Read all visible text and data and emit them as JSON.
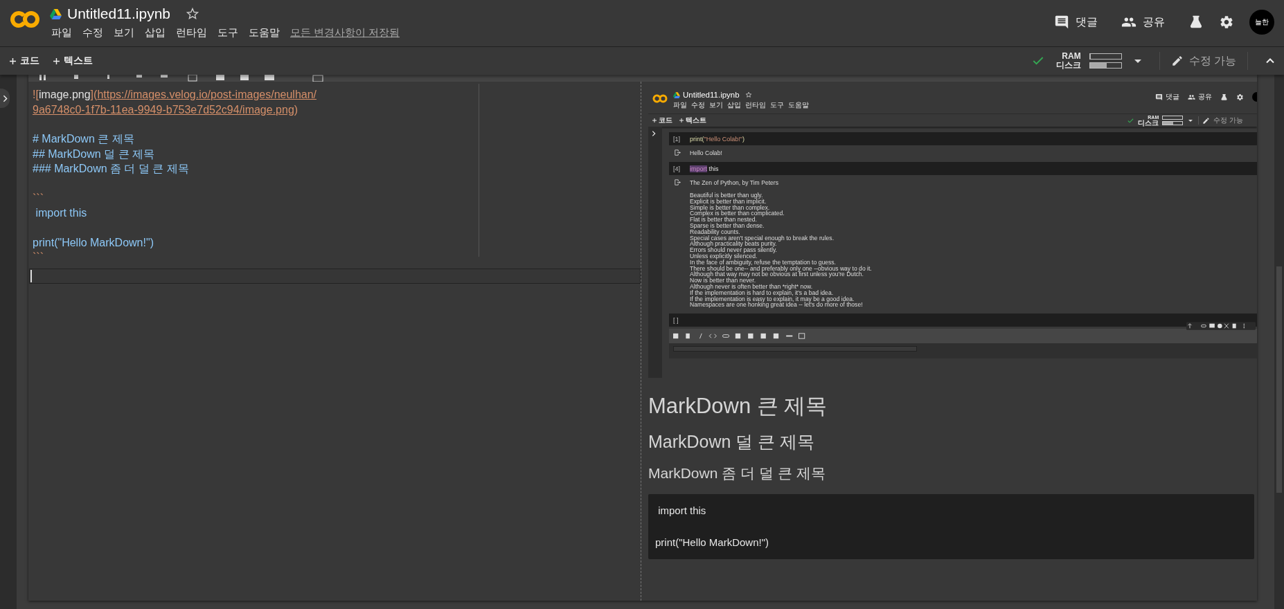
{
  "header": {
    "title": "Untitled11.ipynb",
    "menu": [
      "파일",
      "수정",
      "보기",
      "삽입",
      "런타임",
      "도구",
      "도움말"
    ],
    "save_status": "모든 변경사항이 저장됨",
    "actions": [
      {
        "kind": "comment",
        "label": "댓글"
      },
      {
        "kind": "share",
        "label": "공유"
      }
    ],
    "avatar": "늘한"
  },
  "toolbar": {
    "add_buttons": [
      "코드",
      "텍스트"
    ],
    "ram_label": "RAM",
    "disk_label": "디스크",
    "ram": {
      "level": 0.04
    },
    "disk": {
      "level": 0.55
    },
    "edit_status": "수정 가능"
  },
  "editor": {
    "lines": [
      {
        "kind": "text",
        "segments": [
          {
            "kind": "punct",
            "text": "!["
          },
          {
            "kind": "plain",
            "text": "image.png"
          },
          {
            "kind": "punct",
            "text": "]("
          },
          {
            "kind": "url",
            "text": "https://images.velog.io/post-images/neulhan/"
          }
        ]
      },
      {
        "kind": "text",
        "segments": [
          {
            "kind": "url",
            "text": "9a6748c0-1f7b-11ea-9949-b753e7d52c94/image.png"
          },
          {
            "kind": "punct",
            "text": ")"
          }
        ]
      },
      {
        "kind": "blank"
      },
      {
        "kind": "text",
        "segments": [
          {
            "kind": "heading",
            "text": "# MarkDown 큰 제목"
          }
        ]
      },
      {
        "kind": "text",
        "segments": [
          {
            "kind": "heading",
            "text": "## MarkDown 덜 큰 제목"
          }
        ]
      },
      {
        "kind": "text",
        "segments": [
          {
            "kind": "heading",
            "text": "### MarkDown 좀 더 덜 큰 제목"
          }
        ]
      },
      {
        "kind": "blank"
      },
      {
        "kind": "text",
        "segments": [
          {
            "kind": "punct",
            "text": "```"
          }
        ]
      },
      {
        "kind": "text",
        "segments": [
          {
            "kind": "code",
            "text": " import this"
          }
        ]
      },
      {
        "kind": "blank"
      },
      {
        "kind": "text",
        "segments": [
          {
            "kind": "code",
            "text": "print(\"Hello MarkDown!\")"
          }
        ]
      },
      {
        "kind": "text",
        "segments": [
          {
            "kind": "punct",
            "text": "```"
          }
        ]
      },
      {
        "kind": "cursor"
      }
    ]
  },
  "preview": {
    "screenshot": {
      "title": "Untitled11.ipynb",
      "menu": [
        "파일",
        "수정",
        "보기",
        "삽입",
        "런타임",
        "도구",
        "도움말"
      ],
      "actions": [
        {
          "kind": "comment",
          "label": "댓글"
        },
        {
          "kind": "share",
          "label": "공유"
        }
      ],
      "add_buttons": [
        "코드",
        "텍스트"
      ],
      "ram_label": "RAM",
      "disk_label": "디스크",
      "edit_status": "수정 가능",
      "cells": [
        {
          "kind": "code",
          "prompt": "[1]",
          "code": [
            {
              "kind": "fn",
              "text": "print("
            },
            {
              "kind": "string",
              "text": "\"Hello Colab!\""
            },
            {
              "kind": "fn",
              "text": ")"
            }
          ],
          "output": {
            "title": "Hello Colab!"
          }
        },
        {
          "kind": "code",
          "prompt": "[4]",
          "code": [
            {
              "kind": "keyword",
              "text": "import"
            },
            {
              "kind": "plain",
              "text": " this"
            }
          ],
          "output": {
            "title": "The Zen of Python, by Tim Peters",
            "lines": [
              "Beautiful is better than ugly.",
              "Explicit is better than implicit.",
              "Simple is better than complex.",
              "Complex is better than complicated.",
              "Flat is better than nested.",
              "Sparse is better than dense.",
              "Readability counts.",
              "Special cases aren't special enough to break the rules.",
              "Although practicality beats purity.",
              "Errors should never pass silently.",
              "Unless explicitly silenced.",
              "In the face of ambiguity, refuse the temptation to guess.",
              "There should be one-- and preferably only one --obvious way to do it.",
              "Although that way may not be obvious at first unless you're Dutch.",
              "Now is better than never.",
              "Although never is often better than *right* now.",
              "If the implementation is hard to explain, it's a bad idea.",
              "If the implementation is easy to explain, it may be a good idea.",
              "Namespaces are one honking great idea -- let's do more of those!"
            ]
          }
        },
        {
          "kind": "code",
          "prompt": "[ ]"
        },
        {
          "kind": "text"
        }
      ]
    },
    "headings": [
      {
        "kind": "h1",
        "text": "MarkDown 큰 제목"
      },
      {
        "kind": "h2",
        "text": "MarkDown 덜 큰 제목"
      },
      {
        "kind": "h3",
        "text": "MarkDown 좀 더 덜 큰 제목"
      }
    ],
    "code_block": [
      {
        "kind": "code",
        "text": " import this"
      },
      {
        "kind": "blank"
      },
      {
        "kind": "code",
        "text": "print(\"Hello MarkDown!\")"
      }
    ]
  }
}
